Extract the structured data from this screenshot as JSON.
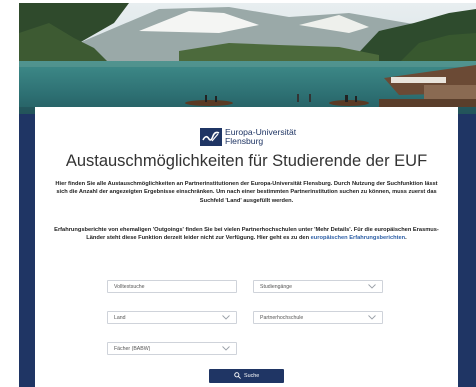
{
  "header": {
    "logo_line1": "Europa-Universität",
    "logo_line2": "Flensburg"
  },
  "page": {
    "title": "Austauschmöglichkeiten für Studierende der EUF",
    "intro": "Hier finden Sie alle Austauschmöglichkeiten an Partnerinstitutionen der Europa-Universität Flensburg. Durch Nutzung der Suchfunktion lässt sich die Anzahl der angezeigten Ergebnisse einschränken. Um nach einer bestimmten Partnerinstitution suchen zu können, muss zuerst das Suchfeld 'Land' ausgefüllt werden.",
    "reports_text": "Erfahrungsberichte von ehemaligen 'Outgoings' finden Sie bei vielen Partnerhochschulen unter 'Mehr Details'. Für die europäischen Erasmus-Länder steht diese Funktion derzeit leider nicht zur Verfügung. Hier geht es zu den ",
    "reports_link": "europäischen Erfahrungsberichten",
    "reports_end": "."
  },
  "filters": {
    "fulltext_placeholder": "Volltextsuche",
    "programs_placeholder": "Studiengänge",
    "country_placeholder": "Land",
    "partner_placeholder": "Partnerhochschule",
    "subjects_placeholder": "Fächer (BABW)"
  },
  "search": {
    "button_label": "Suche",
    "icon": "search-icon"
  },
  "colors": {
    "navy": "#1f3564",
    "link": "#2d5fa6",
    "field_border": "#cfd3da"
  }
}
